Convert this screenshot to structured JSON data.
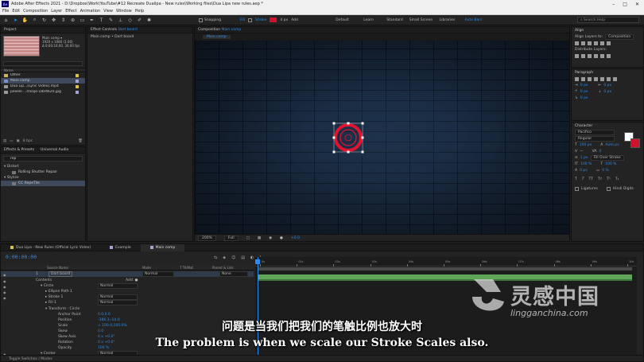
{
  "window": {
    "title": "Adobe After Effects 2021 - D:\\Dropbox\\Work\\YouTube\\#12 Recreate Dualipa - New rules\\Working files\\Dua Lipa new rules.aep *",
    "app_badge": "Ae",
    "minimize": "–",
    "maximize": "□",
    "close": "✕"
  },
  "menu": [
    "File",
    "Edit",
    "Composition",
    "Layer",
    "Effect",
    "Animation",
    "View",
    "Window",
    "Help"
  ],
  "toolbar": {
    "snapping_label": "Snapping",
    "fill_label": "Fill",
    "stroke_label": "Stroke",
    "stroke_width": "4 px",
    "add_label": "Add",
    "workspaces": [
      "Default",
      "Learn",
      "Standard",
      "Small Screen",
      "Libraries",
      "Auto Bars"
    ],
    "active_workspace": "Auto Bars",
    "help_search_placeholder": "Search Help"
  },
  "project": {
    "tab": "Project",
    "comp_name": "Main comp ▾",
    "comp_size": "1920 x 1080 (1.00)",
    "comp_duration": "Δ 0;00;10;00, 30.00 fps",
    "column_name": "Name",
    "items": [
      {
        "label": "Other",
        "type": "folder",
        "color": "#e0c341",
        "selected": false
      },
      {
        "label": "Main comp",
        "type": "comp",
        "color": "#a3a3d6",
        "selected": true
      },
      {
        "label": "Dua Lip...[Lyric Video].mp4",
        "type": "video",
        "color": "#e0c341",
        "selected": false
      },
      {
        "label": "pexels-...msaje-1804620.jpg",
        "type": "image",
        "color": "#a3a3d6",
        "selected": false
      }
    ],
    "bpc": "8 bpc"
  },
  "effects": {
    "tab": "Effects & Presets",
    "tab2": "Universal Audio",
    "search_value": "rep",
    "categories": [
      {
        "label": "▾ Distort",
        "items": [
          {
            "label": "Rolling Shutter Repair",
            "selected": false
          }
        ]
      },
      {
        "label": "▾ Stylize",
        "items": [
          {
            "label": "CC RepeTile",
            "selected": true
          }
        ]
      }
    ]
  },
  "effect_controls": {
    "tab": "Effect Controls",
    "tab_target": "Dart board",
    "subtitle": "Main comp • Dart board"
  },
  "composition": {
    "tab": "Composition",
    "tab_target": "Main comp",
    "breadcrumb": "Main comp",
    "zoom": "200%",
    "resolution": "Full",
    "exposure": "+0.0"
  },
  "align": {
    "title": "Align",
    "align_layers_to_label": "Align Layers to:",
    "align_layers_to_value": "Composition",
    "distribute_label": "Distribute Layers:"
  },
  "paragraph": {
    "title": "Paragraph",
    "indent_left": "0 px",
    "indent_right": "0 px",
    "space_before": "0 px",
    "space_after": "0 px",
    "first_indent": "0 px"
  },
  "character": {
    "title": "Character",
    "font": "Pacifico",
    "style": "Regular",
    "size": "100 px",
    "leading": "Auto px",
    "tracking": "0",
    "stroke_width": "1 px",
    "stroke_mode": "Fill Over Stroke",
    "vscale": "100 %",
    "hscale": "100 %",
    "baseline": "0 px",
    "tsume": "0 %",
    "ligatures": "Ligatures",
    "hindi_digits": "Hindi Digits"
  },
  "timeline": {
    "tabs": [
      {
        "label": "Dua Lipa - New Rules (Official Lyric Video)",
        "color": "#e0c341",
        "active": false
      },
      {
        "label": "Example",
        "color": "#a3a3d6",
        "active": false
      },
      {
        "label": "Main comp",
        "color": "#a3a3d6",
        "active": true
      }
    ],
    "timecode": "0:00:00:00",
    "col_source": "Source Name",
    "col_mode": "Mode",
    "col_trkmat": "T TrkMat",
    "col_parent": "Parent & Link",
    "layer_number": "1",
    "layer_name": "Dart board",
    "layer_mode": "Normal",
    "layer_parent": "None",
    "rows": [
      {
        "label": "Contents",
        "value": "",
        "mode": "",
        "indent": 44
      },
      {
        "label": "▾ Circle",
        "value": "",
        "mode": "Normal",
        "indent": 50
      },
      {
        "label": "▸ Ellipse Path 1",
        "value": "",
        "mode": "",
        "indent": 56
      },
      {
        "label": "▸ Stroke 1",
        "value": "",
        "mode": "Normal",
        "indent": 56
      },
      {
        "label": "▸ Fill 1",
        "value": "",
        "mode": "Normal",
        "indent": 56
      },
      {
        "label": "▾ Transform : Circle",
        "value": "",
        "mode": "",
        "indent": 56
      },
      {
        "label": "Anchor Point",
        "value": "0.0,0.0",
        "mode": "",
        "indent": 72
      },
      {
        "label": "Position",
        "value": "-386.3,-14.0",
        "mode": "",
        "indent": 72
      },
      {
        "label": "Scale",
        "value": "∞ 100.0,100.0%",
        "mode": "",
        "indent": 72
      },
      {
        "label": "Skew",
        "value": "0.0",
        "mode": "",
        "indent": 72
      },
      {
        "label": "Skew Axis",
        "value": "0 x +0.0°",
        "mode": "",
        "indent": 72
      },
      {
        "label": "Rotation",
        "value": "0 x +0.0°",
        "mode": "",
        "indent": 72
      },
      {
        "label": "Opacity",
        "value": "100 %",
        "mode": "",
        "indent": 72
      },
      {
        "label": "▾ Center",
        "value": "",
        "mode": "Normal",
        "indent": 50
      }
    ],
    "add_label": "Add: ●",
    "ruler_ticks": [
      "0s",
      "01s",
      "02s",
      "03s",
      "04s",
      "05s",
      "06s",
      "07s",
      "08s",
      "09s",
      "10s"
    ],
    "bottom_label": "Toggle Switches / Modes"
  },
  "subtitles": {
    "cn": "问题是当我们把我们的笔触比例也放大时",
    "en": "The problem is when we scale our Stroke Scales also."
  },
  "watermark": {
    "cn": "灵感中国",
    "en": "lingganchina.com"
  }
}
